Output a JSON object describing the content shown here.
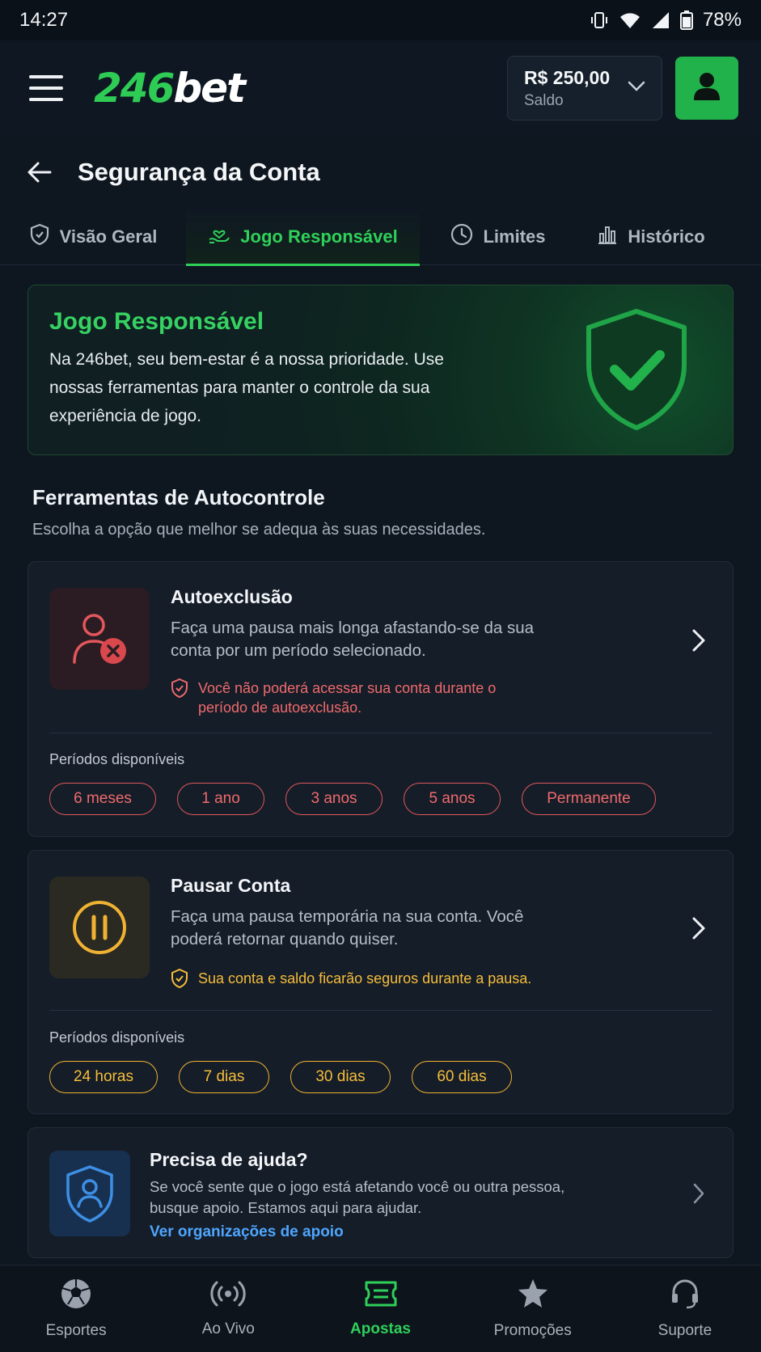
{
  "status_bar": {
    "time": "14:27",
    "battery": "78%",
    "icons": [
      "vibrate-icon",
      "wifi-icon",
      "signal-icon",
      "battery-icon"
    ]
  },
  "header": {
    "logo_number": "246",
    "logo_text": "bet",
    "balance_amount": "R$ 250,00",
    "balance_label": "Saldo"
  },
  "page": {
    "title": "Segurança da Conta"
  },
  "tabs": [
    {
      "label": "Visão Geral",
      "icon": "shield-icon",
      "active": false
    },
    {
      "label": "Jogo Responsável",
      "icon": "hand-heart-icon",
      "active": true
    },
    {
      "label": "Limites",
      "icon": "clock-icon",
      "active": false
    },
    {
      "label": "Histórico",
      "icon": "bar-chart-icon",
      "active": false
    }
  ],
  "hero": {
    "title": "Jogo Responsável",
    "text": "Na 246bet, seu bem-estar é a nossa prioridade. Use nossas ferramentas para manter o controle da sua experiência de jogo."
  },
  "section": {
    "title": "Ferramentas de Autocontrole",
    "subtitle": "Escolha a opção que melhor se adequa às suas necessidades."
  },
  "self_exclusion": {
    "title": "Autoexclusão",
    "description": "Faça uma pausa mais longa afastando-se da sua conta por um período selecionado.",
    "note": "Você não poderá acessar sua conta durante o período de autoexclusão.",
    "periods_label": "Períodos disponíveis",
    "periods": [
      "6 meses",
      "1 ano",
      "3 anos",
      "5 anos",
      "Permanente"
    ]
  },
  "pause_account": {
    "title": "Pausar Conta",
    "description": "Faça uma pausa temporária na sua conta. Você poderá retornar quando quiser.",
    "note": "Sua conta e saldo ficarão seguros durante a pausa.",
    "periods_label": "Períodos disponíveis",
    "periods": [
      "24 horas",
      "7 dias",
      "30 dias",
      "60 dias"
    ]
  },
  "help": {
    "title": "Precisa de ajuda?",
    "description": "Se você sente que o jogo está afetando você ou outra pessoa, busque apoio. Estamos aqui para ajudar.",
    "link": "Ver organizações de apoio"
  },
  "bottom_nav": [
    {
      "label": "Esportes",
      "icon": "soccer-ball-icon",
      "active": false
    },
    {
      "label": "Ao Vivo",
      "icon": "live-broadcast-icon",
      "active": false
    },
    {
      "label": "Apostas",
      "icon": "bet-ticket-icon",
      "active": true
    },
    {
      "label": "Promoções",
      "icon": "star-icon",
      "active": false
    },
    {
      "label": "Suporte",
      "icon": "headset-icon",
      "active": false
    }
  ],
  "colors": {
    "accent_green": "#2fd05a",
    "danger_red": "#ef6a6c",
    "warning_amber": "#f6bd3a",
    "link_blue": "#4ea6ff",
    "background": "#0e1620"
  }
}
